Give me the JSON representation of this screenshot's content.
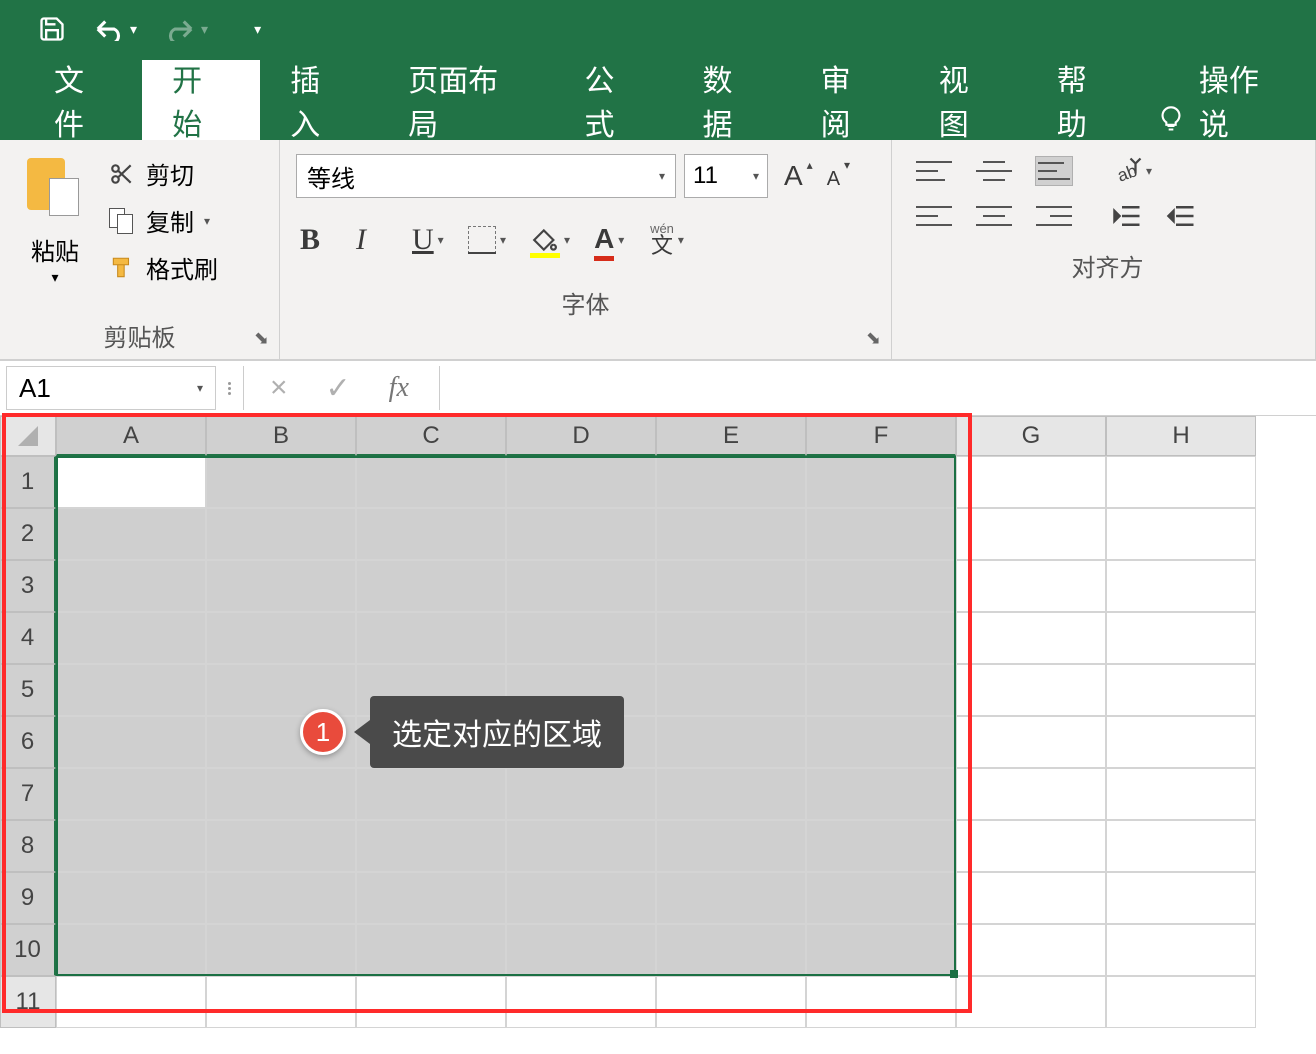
{
  "titlebar": {
    "save": "save-icon",
    "undo": "undo-icon",
    "redo": "redo-icon"
  },
  "tabs": {
    "file": "文件",
    "home": "开始",
    "insert": "插入",
    "layout": "页面布局",
    "formulas": "公式",
    "data": "数据",
    "review": "审阅",
    "view": "视图",
    "help": "帮助",
    "tell_me": "操作说"
  },
  "clipboard": {
    "paste": "粘贴",
    "cut": "剪切",
    "copy": "复制",
    "painter": "格式刷",
    "group_label": "剪贴板"
  },
  "font": {
    "name": "等线",
    "size": "11",
    "bold": "B",
    "italic": "I",
    "underline": "U",
    "font_color_glyph": "A",
    "wen_accent": "wén",
    "wen_char": "文",
    "group_label": "字体"
  },
  "align": {
    "ab": "ab",
    "group_label": "对齐方"
  },
  "formula_bar": {
    "name_box": "A1",
    "cancel": "×",
    "confirm": "✓",
    "fx": "fx"
  },
  "grid": {
    "columns": [
      "A",
      "B",
      "C",
      "D",
      "E",
      "F",
      "G",
      "H"
    ],
    "rows": [
      "1",
      "2",
      "3",
      "4",
      "5",
      "6",
      "7",
      "8",
      "9",
      "10",
      "11"
    ],
    "sel_cols": 6,
    "sel_rows": 10
  },
  "annotation": {
    "number": "1",
    "text": "选定对应的区域"
  }
}
